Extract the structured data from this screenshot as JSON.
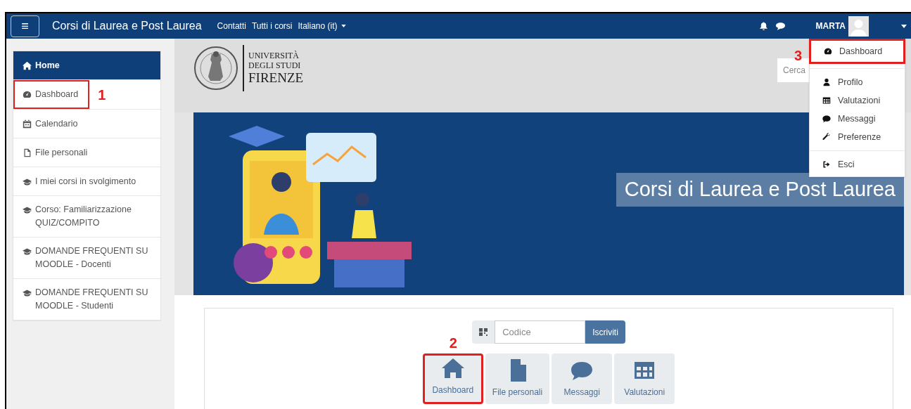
{
  "navbar": {
    "menu_icon": "≡",
    "brand": "Corsi di Laurea e Post Laurea",
    "links": [
      {
        "label": "Contatti",
        "dropdown": false
      },
      {
        "label": "Tutti i corsi",
        "dropdown": false
      },
      {
        "label": "Italiano (it)",
        "dropdown": true
      }
    ],
    "user": "MARTA"
  },
  "sidebar": {
    "items": [
      {
        "kind": "home",
        "label": "Home",
        "selected": true,
        "highlighted": false
      },
      {
        "kind": "dashboard",
        "label": "Dashboard",
        "selected": false,
        "highlighted": true,
        "annotation": "1"
      },
      {
        "kind": "calendar",
        "label": "Calendario",
        "selected": false,
        "highlighted": false
      },
      {
        "kind": "file",
        "label": "File personali",
        "selected": false,
        "highlighted": false
      },
      {
        "kind": "cap",
        "label": "I miei corsi in svolgimento",
        "selected": false,
        "highlighted": false
      },
      {
        "kind": "cap",
        "label": "Corso: Familiarizzazione QUIZ/COMPITO",
        "selected": false,
        "highlighted": false
      },
      {
        "kind": "cap",
        "label": "DOMANDE FREQUENTI SU MOODLE - Docenti",
        "selected": false,
        "highlighted": false
      },
      {
        "kind": "cap",
        "label": "DOMANDE FREQUENTI SU MOODLE - Studenti",
        "selected": false,
        "highlighted": false
      }
    ]
  },
  "logo": {
    "lines": [
      "UNIVERSITÀ",
      "DEGLI STUDI",
      "FIRENZE"
    ]
  },
  "search": {
    "placeholder": "Cerca"
  },
  "banner": {
    "title": "Corsi di Laurea e Post Laurea"
  },
  "enrol": {
    "placeholder": "Codice",
    "button": "Iscriviti"
  },
  "tiles": [
    {
      "kind": "home",
      "label": "Dashboard",
      "highlighted": true,
      "annotation": "2"
    },
    {
      "kind": "file",
      "label": "File personali",
      "highlighted": false
    },
    {
      "kind": "chat",
      "label": "Messaggi",
      "highlighted": false
    },
    {
      "kind": "table",
      "label": "Valutazioni",
      "highlighted": false
    }
  ],
  "user_menu": {
    "annotation": "3",
    "items": [
      {
        "kind": "dashboard",
        "label": "Dashboard",
        "highlighted": true,
        "divider_after": true
      },
      {
        "kind": "user",
        "label": "Profilo",
        "highlighted": false,
        "divider_after": false
      },
      {
        "kind": "table",
        "label": "Valutazioni",
        "highlighted": false,
        "divider_after": false
      },
      {
        "kind": "chat",
        "label": "Messaggi",
        "highlighted": false,
        "divider_after": false
      },
      {
        "kind": "wrench",
        "label": "Preferenze",
        "highlighted": false,
        "divider_after": true
      },
      {
        "kind": "exit",
        "label": "Esci",
        "highlighted": false,
        "divider_after": false
      }
    ]
  }
}
